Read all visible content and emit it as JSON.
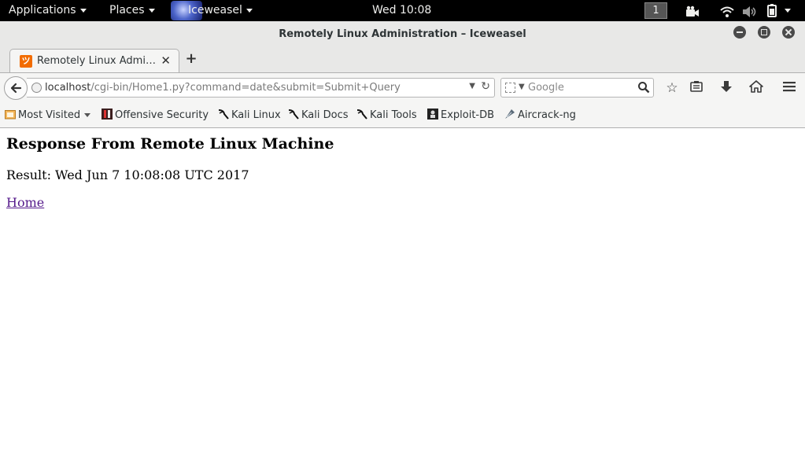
{
  "panel": {
    "applications_label": "Applications",
    "places_label": "Places",
    "active_app_label": "Iceweasel",
    "clock": "Wed 10:08",
    "workspace_number": "1"
  },
  "window": {
    "title": "Remotely Linux Administration – Iceweasel"
  },
  "tabs": [
    {
      "title": "Remotely Linux Admi…",
      "favicon": "ツ",
      "active": true
    }
  ],
  "navbar": {
    "url_host": "localhost",
    "url_path": "/cgi-bin/Home1.py?command=date&submit=Submit+Query",
    "search_placeholder": "Google"
  },
  "bookmarks": [
    {
      "label": "Most Visited",
      "icon": "folder-icon"
    },
    {
      "label": "Offensive Security",
      "icon": "offsec-icon"
    },
    {
      "label": "Kali Linux",
      "icon": "kali-dragon-icon"
    },
    {
      "label": "Kali Docs",
      "icon": "kali-dragon-icon"
    },
    {
      "label": "Kali Tools",
      "icon": "kali-dragon-icon"
    },
    {
      "label": "Exploit-DB",
      "icon": "exploit-db-icon"
    },
    {
      "label": "Aircrack-ng",
      "icon": "aircrack-icon"
    }
  ],
  "page": {
    "heading": "Response From Remote Linux Machine",
    "result": "Result: Wed Jun 7 10:08:08 UTC 2017",
    "home_link": "Home"
  },
  "colors": {
    "panel_bg": "#000000",
    "chrome_bg": "#e8e8e7",
    "toolbar_bg": "#f5f5f4",
    "visited_link": "#551a8b",
    "favicon_orange": "#f26c00"
  }
}
